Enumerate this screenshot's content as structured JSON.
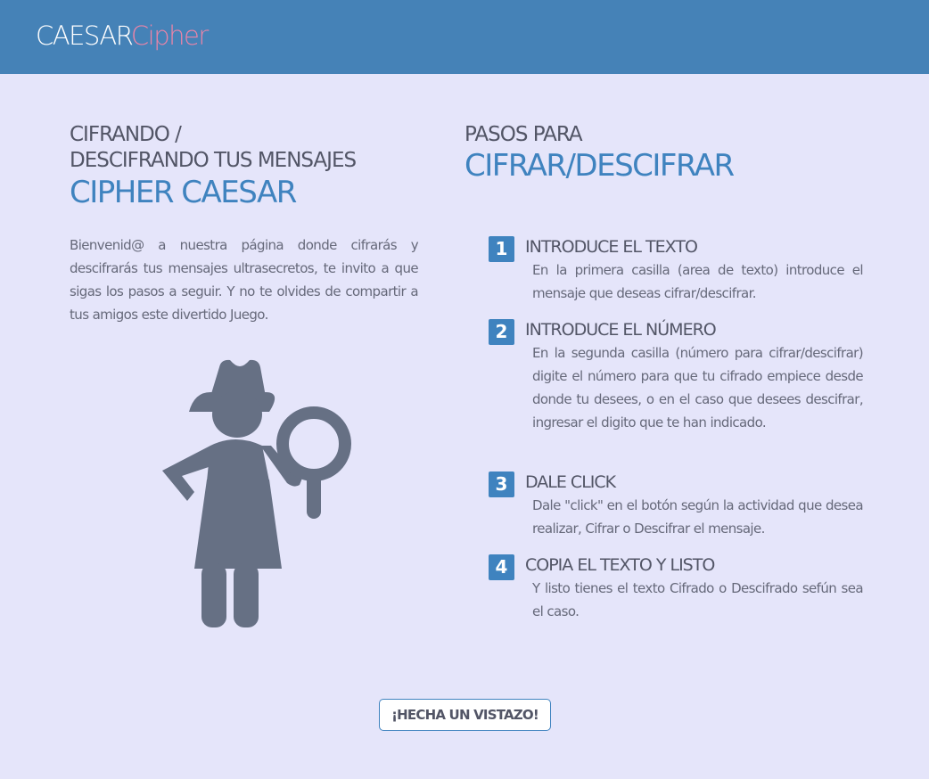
{
  "header": {
    "logo_part1": "CAESAR",
    "logo_part2": "Cipher",
    "colors": {
      "bar": "#4582b7",
      "logo_white": "#ffffff",
      "logo_pink": "#ea84a8"
    }
  },
  "left": {
    "heading_line1": "CIFRANDO /",
    "heading_line2": "DESCIFRANDO TUS MENSAJES",
    "heading_big": "CIPHER CAESAR",
    "intro": "Bienvenid@ a nuestra página donde cifrarás y descifrarás tus mensajes ultrasecretos, te invito a que sigas los pasos a seguir. Y no te olvides de compartir a tus amigos este divertido Juego.",
    "illustration_icon": "detective-girl-magnifier-icon"
  },
  "right": {
    "heading_small": "PASOS PARA",
    "heading_big": "CIFRAR/DESCIFRAR",
    "steps": [
      {
        "number": "1",
        "title": "INTRODUCE EL TEXTO",
        "description": "En la primera casilla (area de texto) introduce el mensaje que deseas cifrar/descifrar."
      },
      {
        "number": "2",
        "title": "INTRODUCE EL NÚMERO",
        "description": "En la segunda casilla (número para cifrar/descifrar) digite el número para que tu cifrado empiece desde donde tu desees, o en el caso que desees descifrar, ingresar el digito que te han indicado."
      },
      {
        "number": "3",
        "title": "DALE CLICK",
        "description": "Dale \"click\" en el botón según la actividad que desea realizar, Cifrar o Descifrar el mensaje."
      },
      {
        "number": "4",
        "title": "COPIA EL TEXTO Y LISTO",
        "description": "Y listo tienes el texto Cifrado o Descifrado sefún sea el caso."
      }
    ]
  },
  "cta": {
    "label": "¡HECHA UN VISTAZO!"
  },
  "colors": {
    "background": "#e5e5fa",
    "accent": "#3f83bf",
    "text": "#66697a",
    "illustration": "#667084"
  }
}
